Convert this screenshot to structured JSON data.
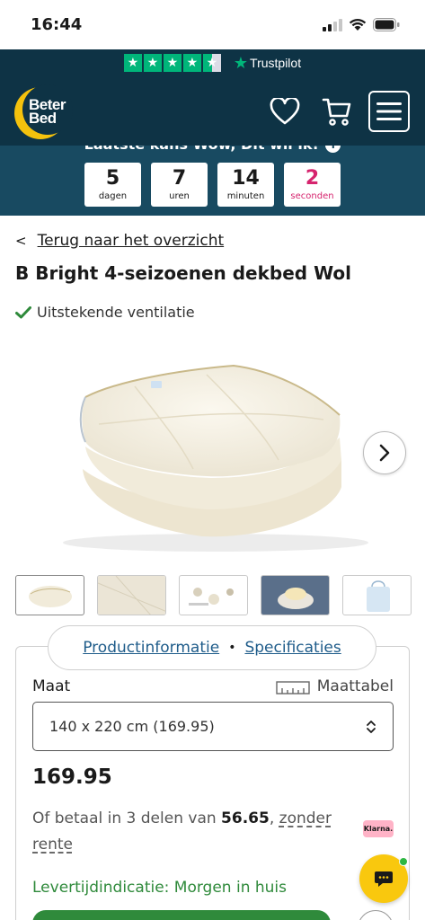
{
  "status_bar": {
    "time": "16:44"
  },
  "trustpilot": {
    "label": "Trustpilot",
    "stars": 4.5
  },
  "header": {
    "logo_line1": "Beter",
    "logo_line2": "Bed"
  },
  "countdown": {
    "banner_text": "Laatste kans Wow, Dit wil ik!",
    "days": "5",
    "days_label": "dagen",
    "hours": "7",
    "hours_label": "uren",
    "minutes": "14",
    "minutes_label": "minuten",
    "seconds": "2",
    "seconds_label": "seconden"
  },
  "nav": {
    "back_label": "Terug naar het overzicht"
  },
  "product": {
    "title": "B Bright 4-seizoenen dekbed Wol",
    "usp": "Uitstekende ventilatie",
    "tabs": [
      "Productinformatie",
      "Specificaties"
    ],
    "size_label": "Maat",
    "size_chart_label": "Maattabel",
    "selected_size": "140 x 220 cm (169.95)",
    "price": "169.95",
    "installments_prefix": "Of betaal in 3 delen van ",
    "installment_amount": "56.65",
    "installments_suffix": "zonder rente",
    "klarna_label": "Klarna.",
    "delivery": "Levertijdindicatie: Morgen in huis"
  },
  "colors": {
    "navy": "#0e3345",
    "teal": "#184a61",
    "green": "#2f8a3b",
    "accent_pink": "#d6246e",
    "trustpilot_green": "#00b67a",
    "chat_yellow": "#f9c80e"
  },
  "icons": [
    "signal-icon",
    "wifi-icon",
    "battery-icon",
    "heart-icon",
    "cart-icon",
    "menu-icon",
    "info-icon",
    "check-icon",
    "chevron-left-icon",
    "chevron-right-icon",
    "ruler-icon",
    "select-arrows-icon",
    "chat-icon"
  ]
}
